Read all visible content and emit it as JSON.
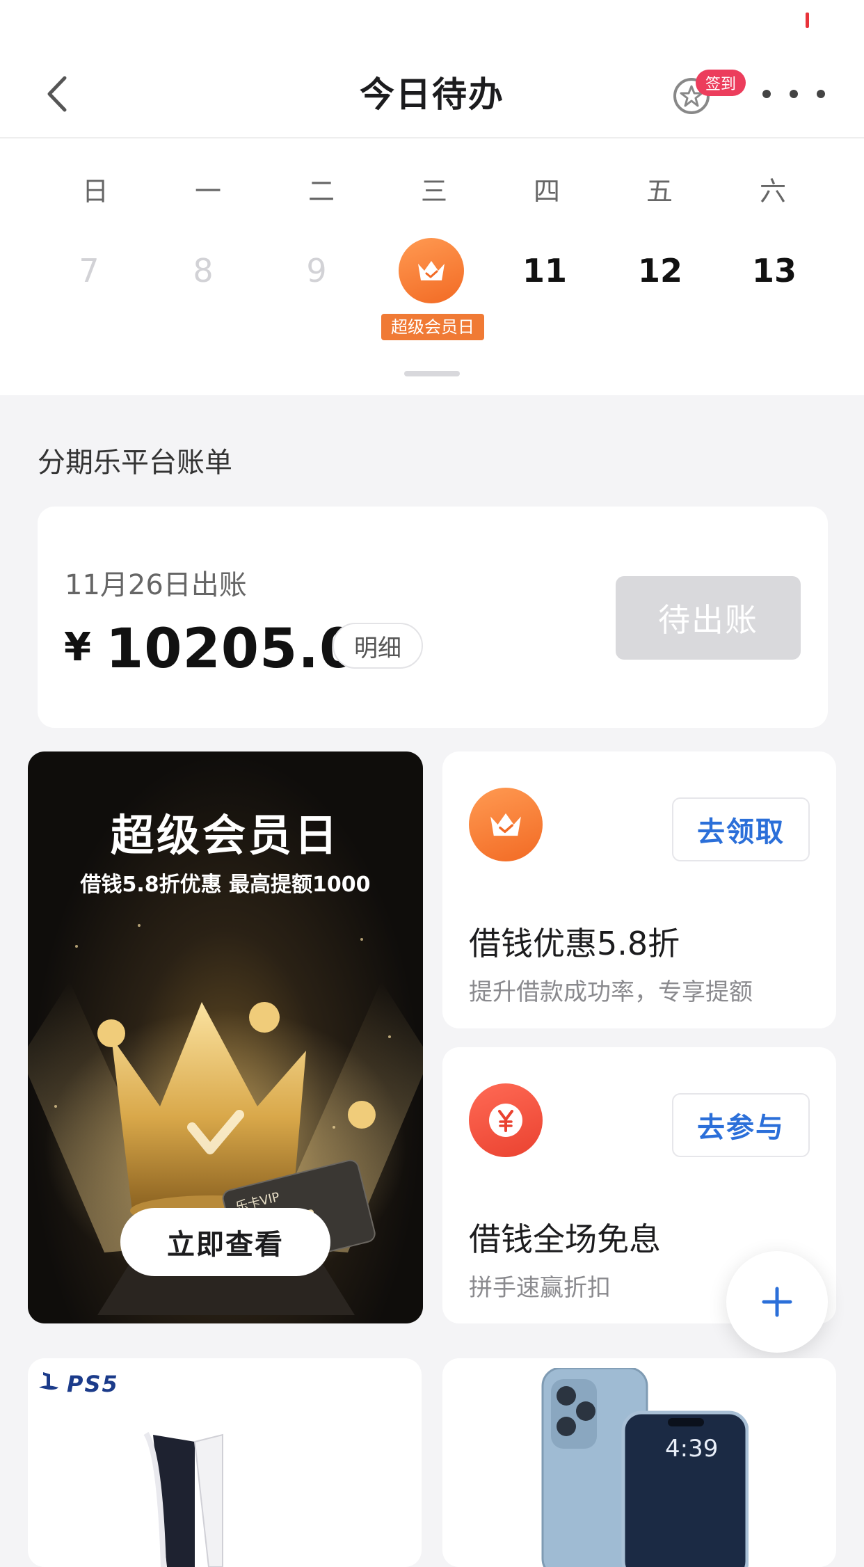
{
  "header": {
    "title": "今日待办",
    "signin_label": "签到",
    "colors": {
      "signin_tag": "#ec3d5c"
    }
  },
  "calendar": {
    "weekdays": [
      "日",
      "一",
      "二",
      "三",
      "四",
      "五",
      "六"
    ],
    "days": [
      "7",
      "8",
      "9",
      "",
      "11",
      "12",
      "13"
    ],
    "today_label": "超级会员日",
    "colors": {
      "today": "#f07a35"
    }
  },
  "bill": {
    "section_title": "分期乐平台账单",
    "date": "11月26日出账",
    "currency": "¥",
    "amount": "10205.00",
    "detail_label": "明细",
    "status_label": "待出账"
  },
  "promo": {
    "title": "超级会员日",
    "subtitle": "借钱5.8折优惠 最高提额1000",
    "card_text": "乐卡VIP",
    "button_label": "立即查看"
  },
  "offers": [
    {
      "icon": "crown-icon",
      "button_label": "去领取",
      "title": "借钱优惠5.8折",
      "subtitle": "提升借款成功率，专享提额"
    },
    {
      "icon": "yen-icon",
      "button_label": "去参与",
      "title": "借钱全场免息",
      "subtitle": "拼手速赢折扣"
    }
  ],
  "products": {
    "left_logo": "PS5",
    "right_time": "4:39"
  },
  "colors": {
    "accent_orange": "#f26a24",
    "link_blue": "#2b6fd9",
    "background": "#f4f4f6"
  }
}
